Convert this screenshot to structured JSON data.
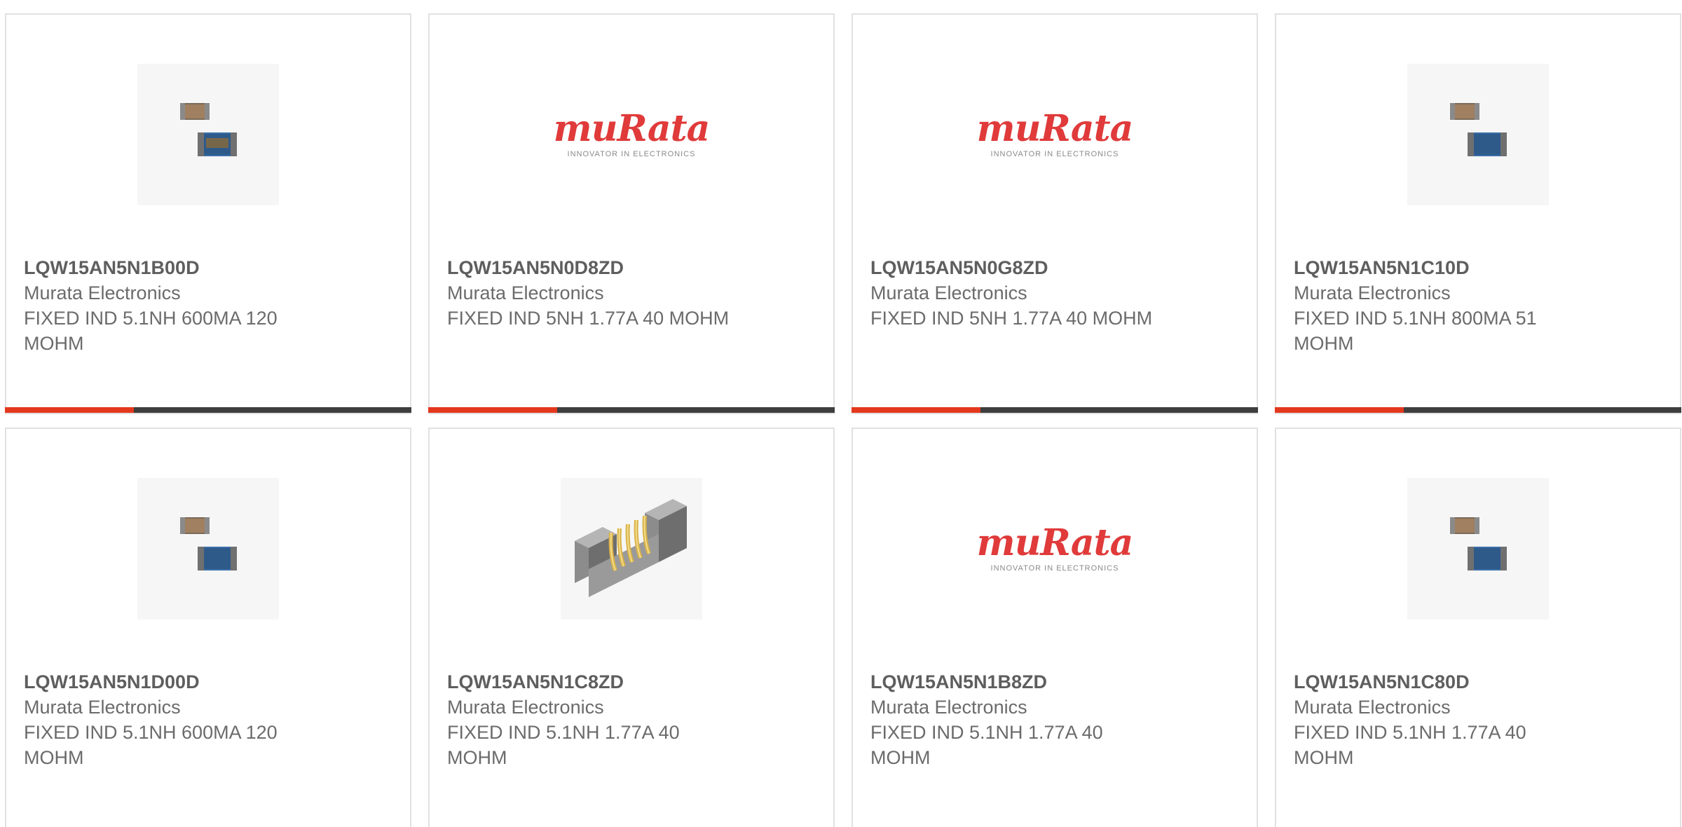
{
  "products": [
    {
      "part": "LQW15AN5N1B00D",
      "manufacturer": "Murata Electronics",
      "description": "FIXED IND 5.1NH 600MA 120 MOHM",
      "image": "chip-inductor-photo"
    },
    {
      "part": "LQW15AN5N0D8ZD",
      "manufacturer": "Murata Electronics",
      "description": "FIXED IND 5NH 1.77A 40 MOHM",
      "image": "murata-logo"
    },
    {
      "part": "LQW15AN5N0G8ZD",
      "manufacturer": "Murata Electronics",
      "description": "FIXED IND 5NH 1.77A 40 MOHM",
      "image": "murata-logo"
    },
    {
      "part": "LQW15AN5N1C10D",
      "manufacturer": "Murata Electronics",
      "description": "FIXED IND 5.1NH 800MA 51 MOHM",
      "image": "chip-inductor-photo"
    },
    {
      "part": "LQW15AN5N1D00D",
      "manufacturer": "Murata Electronics",
      "description": "FIXED IND 5.1NH 600MA 120 MOHM",
      "image": "chip-inductor-photo"
    },
    {
      "part": "LQW15AN5N1C8ZD",
      "manufacturer": "Murata Electronics",
      "description": "FIXED IND 5.1NH 1.77A 40 MOHM",
      "image": "wirewound-inductor-photo"
    },
    {
      "part": "LQW15AN5N1B8ZD",
      "manufacturer": "Murata Electronics",
      "description": "FIXED IND 5.1NH 1.77A 40 MOHM",
      "image": "murata-logo"
    },
    {
      "part": "LQW15AN5N1C80D",
      "manufacturer": "Murata Electronics",
      "description": "FIXED IND 5.1NH 1.77A 40 MOHM",
      "image": "chip-inductor-photo"
    }
  ],
  "logo": {
    "brand": "muRata",
    "tagline": "INNOVATOR IN ELECTRONICS"
  },
  "colors": {
    "accent": "#e4381d",
    "bar": "#3e3e3e",
    "logo_red": "#e03a3a"
  }
}
